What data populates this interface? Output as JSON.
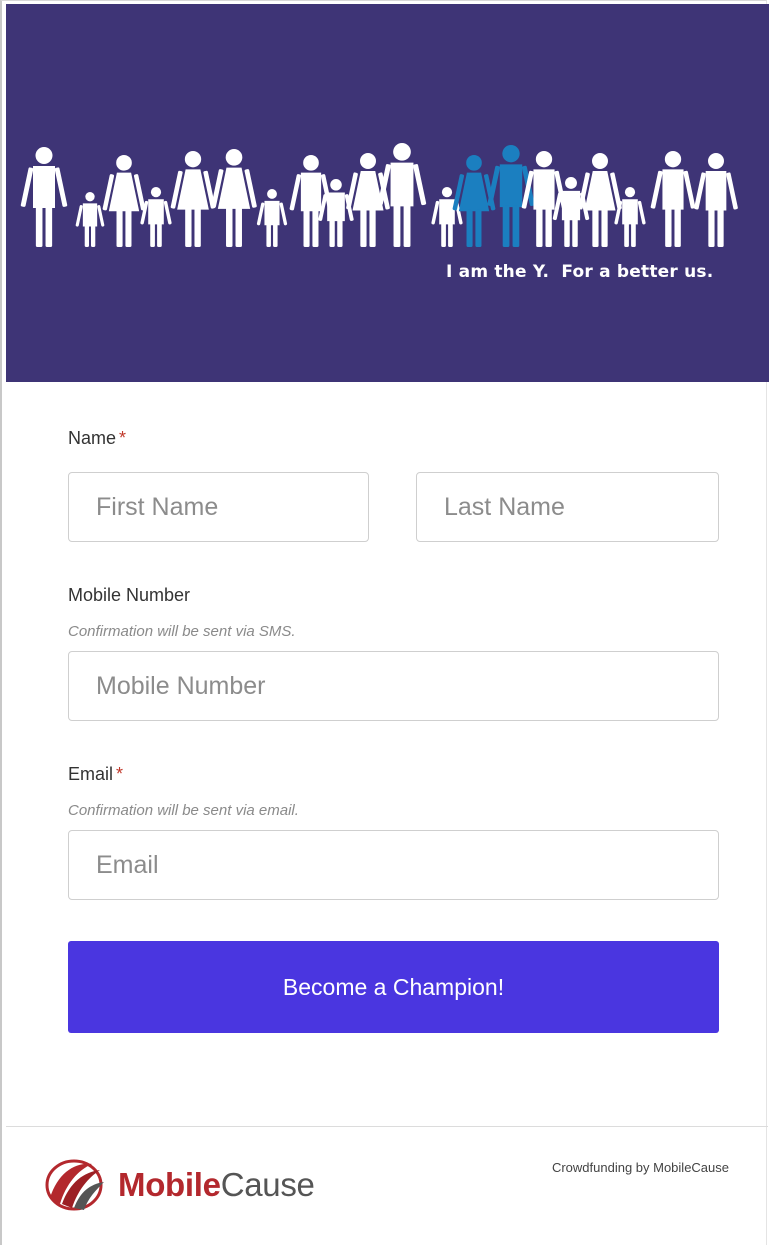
{
  "banner": {
    "tagline": "I am the Y.  For a better us.",
    "background_color": "#3e3476",
    "figure_color": "#ffffff",
    "highlight_color": "#1b7fc0"
  },
  "form": {
    "name": {
      "label": "Name",
      "required_mark": "*",
      "first_placeholder": "First Name",
      "last_placeholder": "Last Name"
    },
    "mobile": {
      "label": "Mobile Number",
      "hint": "Confirmation will be sent via SMS.",
      "placeholder": "Mobile Number"
    },
    "email": {
      "label": "Email",
      "required_mark": "*",
      "hint": "Confirmation will be sent via email.",
      "placeholder": "Email"
    },
    "submit_label": "Become a Champion!",
    "submit_color": "#4a36e0"
  },
  "footer": {
    "logo_bold": "Mobile",
    "logo_regular": "Cause",
    "powered_by": "Crowdfunding by MobileCause",
    "brand_red": "#b3282d"
  }
}
